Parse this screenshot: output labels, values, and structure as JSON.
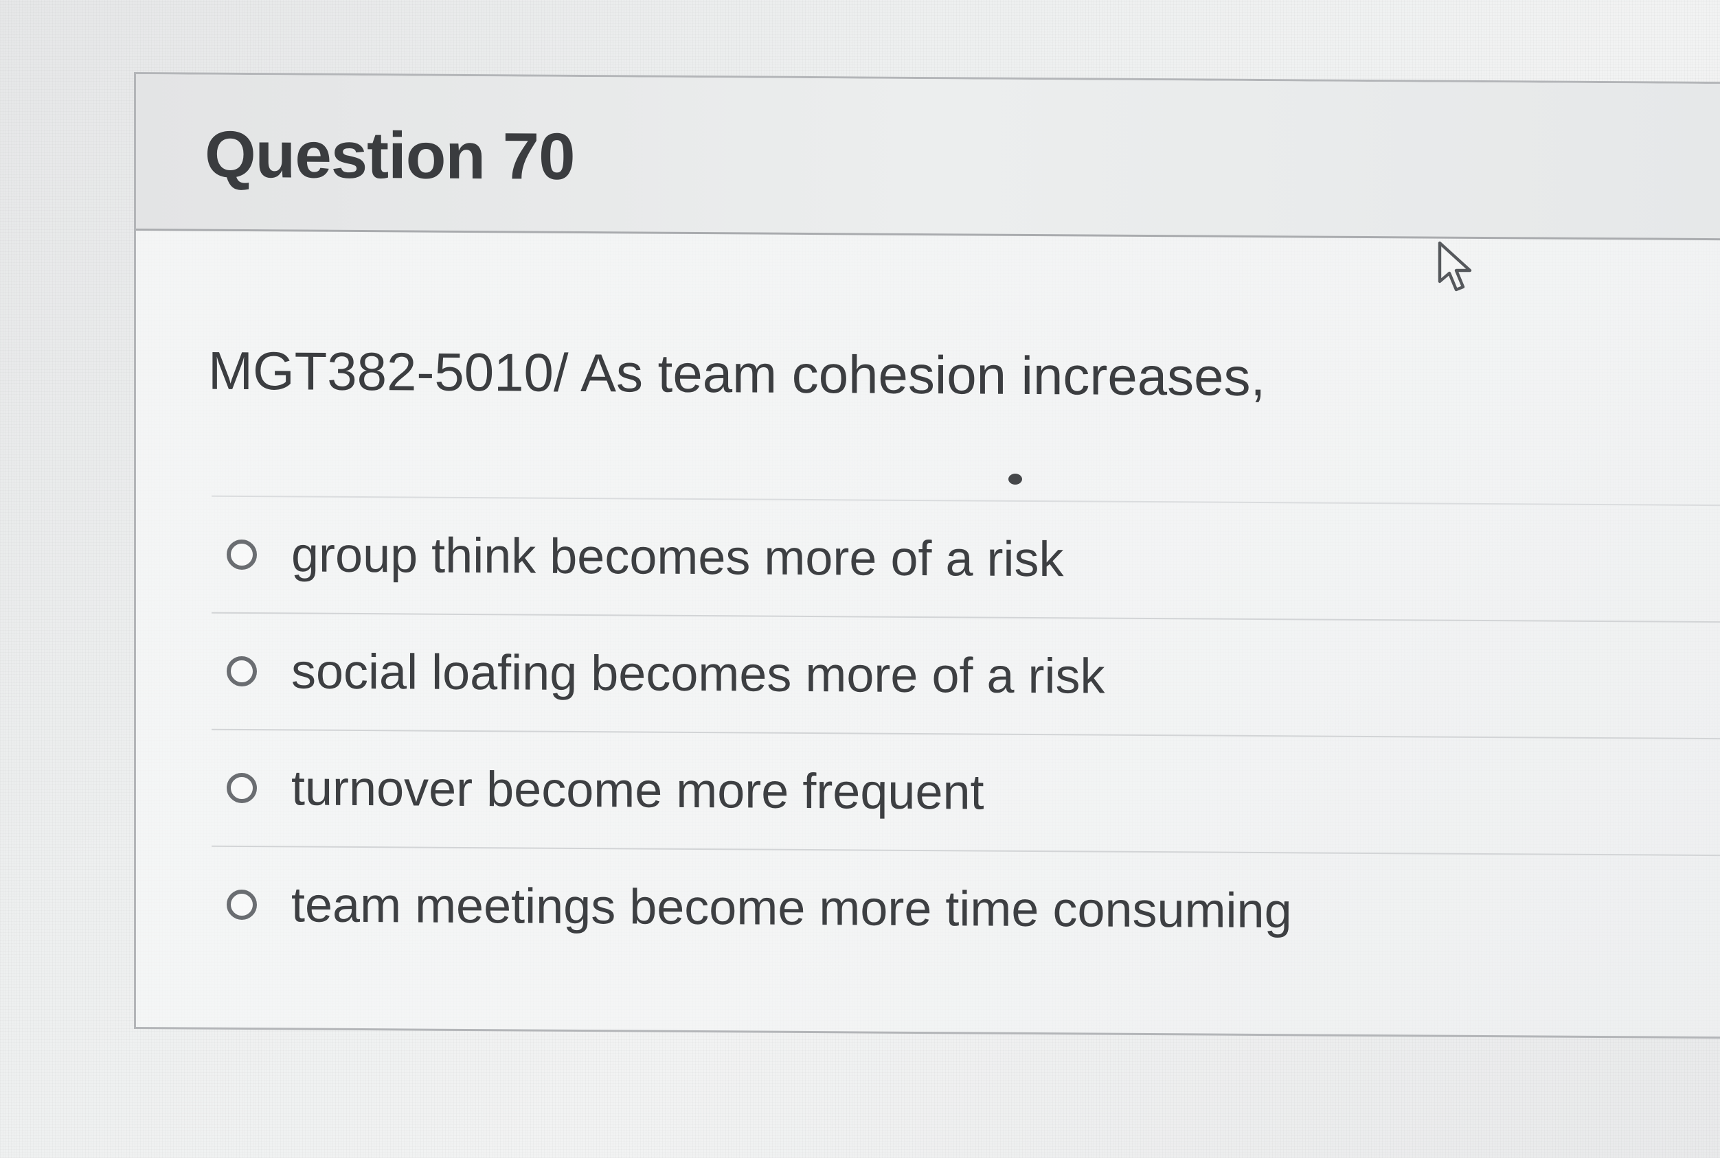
{
  "question": {
    "title": "Question 70",
    "text": "MGT382-5010/ As team cohesion increases,",
    "answers": [
      {
        "label": "group think becomes more of a risk",
        "selected": false
      },
      {
        "label": "social loafing becomes more of a risk",
        "selected": false
      },
      {
        "label": "turnover become more frequent",
        "selected": false
      },
      {
        "label": "team meetings become more time consuming",
        "selected": false
      }
    ]
  },
  "icons": {
    "radio": "radio-button-empty-icon",
    "cursor": "mouse-pointer-icon"
  }
}
